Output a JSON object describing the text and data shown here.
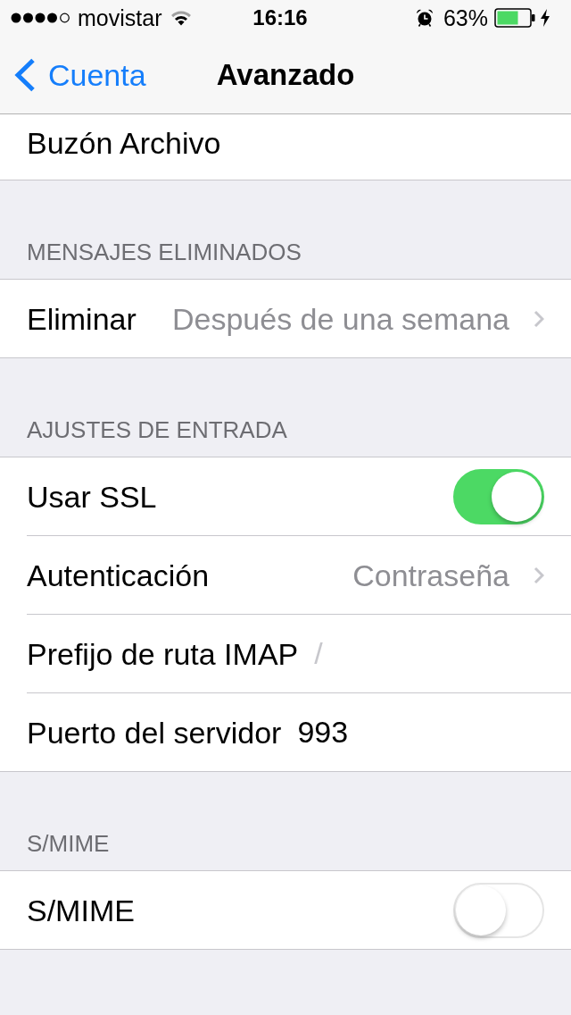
{
  "status_bar": {
    "carrier": "movistar",
    "time": "16:16",
    "battery": "63%"
  },
  "nav_bar": {
    "back": "Cuenta",
    "title": "Avanzado"
  },
  "sections": [
    {
      "rows": [
        {
          "kind": "plain",
          "label": "Buzón Archivo"
        }
      ]
    },
    {
      "header": "MENSAJES ELIMINADOS",
      "rows": [
        {
          "kind": "disclosure",
          "label": "Eliminar",
          "value": "Después de una semana"
        }
      ]
    },
    {
      "header": "AJUSTES DE ENTRADA",
      "rows": [
        {
          "kind": "switch",
          "label": "Usar SSL",
          "on": true
        },
        {
          "kind": "disclosure",
          "label": "Autenticación",
          "value": "Contraseña"
        },
        {
          "kind": "field",
          "label": "Prefijo de ruta IMAP",
          "placeholder": "/"
        },
        {
          "kind": "field",
          "label": "Puerto del servidor",
          "value": "993"
        }
      ]
    },
    {
      "header": "S/MIME",
      "rows": [
        {
          "kind": "switch",
          "label": "S/MIME",
          "on": false
        }
      ]
    }
  ]
}
